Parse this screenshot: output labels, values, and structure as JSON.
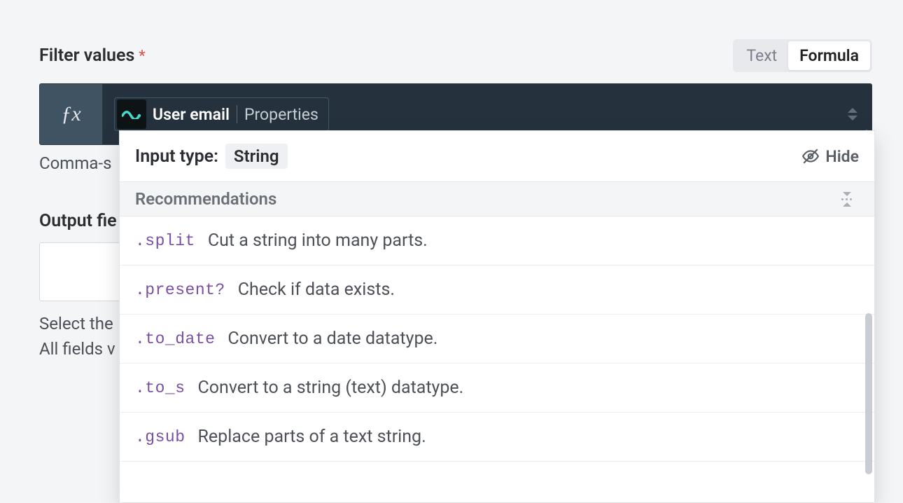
{
  "filter": {
    "label": "Filter values",
    "required_marker": "*",
    "hint_below": "Comma-s",
    "pill": {
      "icon_name": "squiggle-icon",
      "field": "User email",
      "sublabel": "Properties"
    },
    "mode_toggle": {
      "text": "Text",
      "formula": "Formula",
      "active": "formula"
    }
  },
  "output": {
    "label": "Output fie",
    "hint_line1": "Select the",
    "hint_line2": "All fields v"
  },
  "dropdown": {
    "input_type_label": "Input type:",
    "input_type_value": "String",
    "hide_label": "Hide",
    "group_title": "Recommendations",
    "items": [
      {
        "method": ".split",
        "desc": "Cut a string into many parts."
      },
      {
        "method": ".present?",
        "desc": "Check if data exists."
      },
      {
        "method": ".to_date",
        "desc": "Convert to a date datatype."
      },
      {
        "method": ".to_s",
        "desc": "Convert to a string (text) datatype."
      },
      {
        "method": ".gsub",
        "desc": "Replace parts of a text string."
      }
    ]
  }
}
